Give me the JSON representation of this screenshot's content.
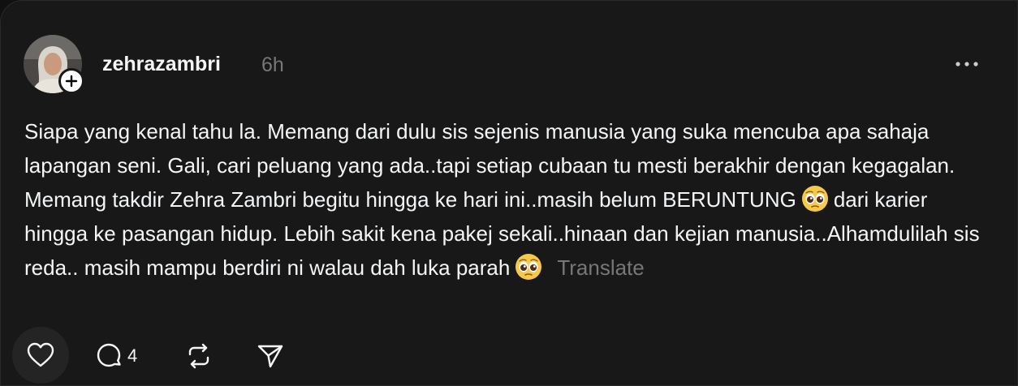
{
  "post": {
    "username": "zehrazambri",
    "time": "6h",
    "text_part1": "Siapa yang kenal tahu la. Memang dari dulu sis sejenis manusia yang suka mencuba apa sahaja lapangan seni. Gali, cari peluang yang ada..tapi setiap cubaan tu mesti berakhir dengan kegagalan. Memang takdir Zehra Zambri begitu hingga ke hari ini..masih belum BERUNTUNG",
    "text_part2": "dari karier hingga ke pasangan hidup. Lebih sakit kena pakej sekali..hinaan dan kejian manusia..Alhamdulilah sis reda.. masih mampu berdiri ni walau dah luka parah",
    "emoji": "pleading-face",
    "translate_label": "Translate"
  },
  "actions": {
    "reply_count": "4"
  },
  "icons": {
    "like": "heart-icon",
    "reply": "comment-icon",
    "repost": "repost-icon",
    "share": "send-icon",
    "more": "more-icon",
    "follow": "plus-icon"
  }
}
